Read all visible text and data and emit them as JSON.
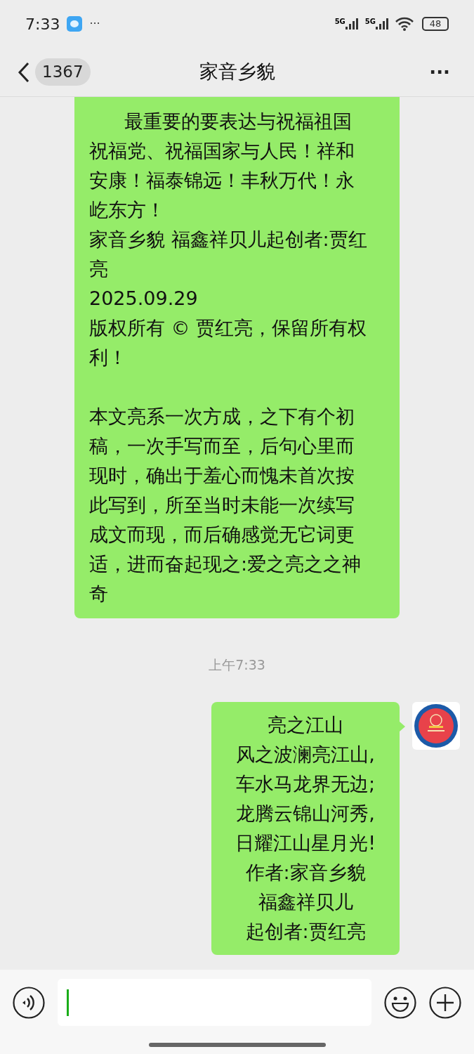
{
  "status_bar": {
    "time": "7:33",
    "more": "···",
    "network_1": "5G",
    "network_2": "5G",
    "battery": "48"
  },
  "header": {
    "unread_count": "1367",
    "title": "家音乡貌",
    "more": "···"
  },
  "messages": [
    {
      "kind": "text",
      "lines": [
        {
          "text": "最重要的要表达与祝福祖国",
          "indent": true
        },
        {
          "text": "祝福党、祝福国家与人民！祥和",
          "indent": false
        },
        {
          "text": "安康！福泰锦远！丰秋万代！永",
          "indent": false
        },
        {
          "text": "屹东方！",
          "indent": false
        },
        {
          "text": "家音乡貌 福鑫祥贝儿起创者:贾红",
          "indent": false
        },
        {
          "text": "亮",
          "indent": false
        },
        {
          "text": "2025.09.29",
          "indent": false
        },
        {
          "text": "版权所有 © 贾红亮，保留所有权",
          "indent": false
        },
        {
          "text": "利！",
          "indent": false
        },
        {
          "kind": "blank"
        },
        {
          "text": "本文亮系一次方成，之下有个初",
          "indent": false
        },
        {
          "text": "稿，一次手写而至，后句心里而",
          "indent": false
        },
        {
          "text": "现时，确出于羞心而愧未首次按",
          "indent": false
        },
        {
          "text": "此写到，所至当时未能一次续写",
          "indent": false
        },
        {
          "text": "成文而现，而后确感觉无它词更",
          "indent": false
        },
        {
          "text": "适，进而奋起现之:爱之亮之之神",
          "indent": false
        },
        {
          "text": "奇",
          "indent": false
        }
      ]
    },
    {
      "kind": "time",
      "text": "上午7:33"
    },
    {
      "kind": "text",
      "avatar": true,
      "centered": true,
      "lines": [
        {
          "text": "亮之江山",
          "indent": false
        },
        {
          "text": "风之波澜亮江山,",
          "indent": false
        },
        {
          "text": "车水马龙界无边;",
          "indent": false
        },
        {
          "text": "龙腾云锦山河秀,",
          "indent": false
        },
        {
          "text": "日耀江山星月光!",
          "indent": false
        },
        {
          "text": "作者:家音乡貌",
          "indent": false
        },
        {
          "text": "福鑫祥贝儿",
          "indent": false
        },
        {
          "text": "起创者:贾红亮",
          "indent": false
        }
      ]
    }
  ],
  "input": {
    "focused": true
  }
}
